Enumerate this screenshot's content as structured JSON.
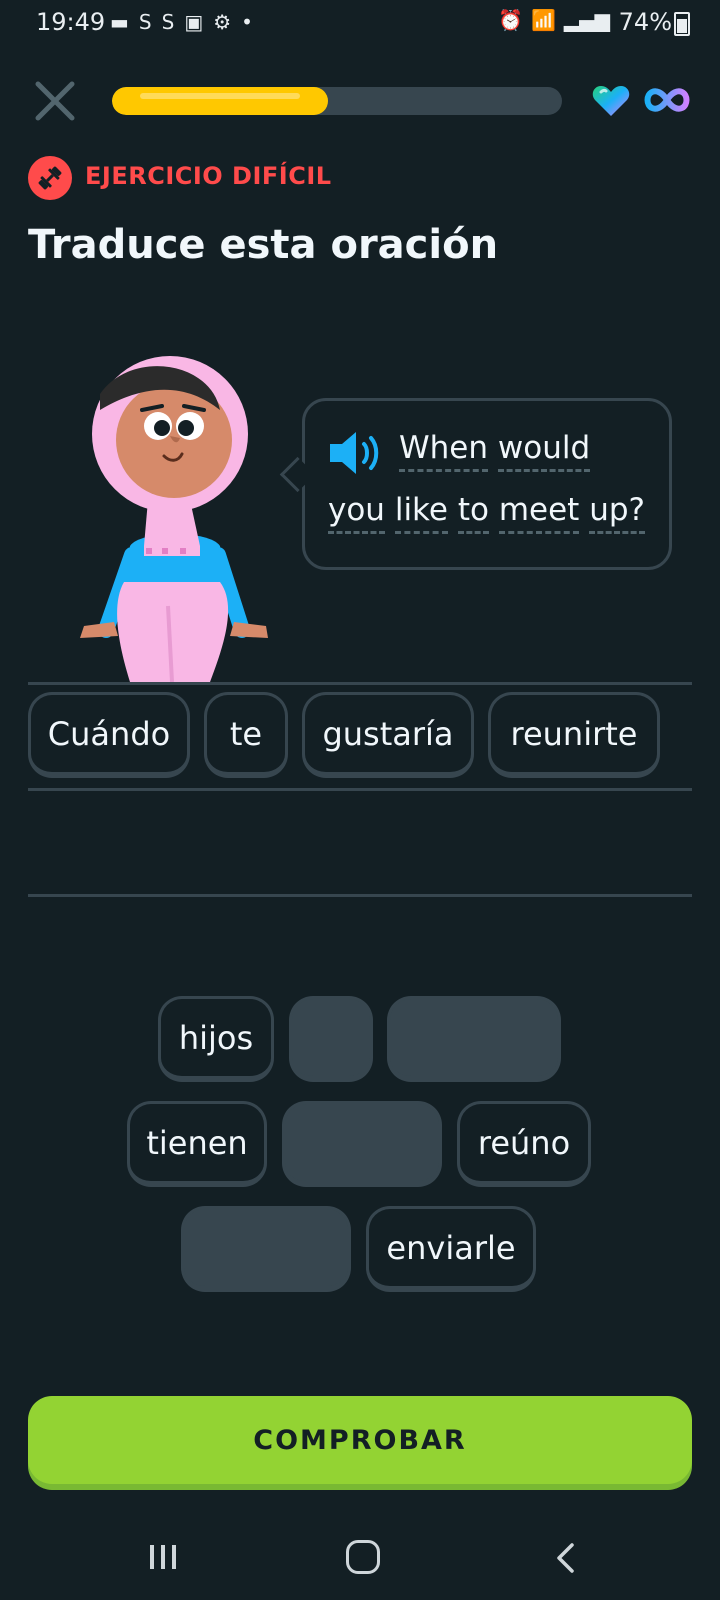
{
  "status_bar": {
    "time": "19:49",
    "battery": "74%"
  },
  "header": {
    "progress": 0.48,
    "close_icon": "close-icon",
    "hearts_icon": "heart-gem-icon",
    "infinity_icon": "infinity-icon"
  },
  "exercise": {
    "hard_label": "EJERCICIO DIFÍCIL",
    "title": "Traduce esta oración",
    "prompt_line1": "When would",
    "prompt_line2": "you like to meet up?",
    "prompt_words": [
      "When",
      "would",
      "you",
      "like",
      "to",
      "meet",
      "up?"
    ]
  },
  "answer_tiles": [
    "Cuándo",
    "te",
    "gustaría",
    "reunirte"
  ],
  "word_bank": {
    "row1": [
      "hijos",
      "",
      ""
    ],
    "row2": [
      "tienen",
      "",
      "reúno"
    ],
    "row3": [
      "",
      "enviarle"
    ]
  },
  "check_button": "COMPROBAR",
  "colors": {
    "background": "#131f24",
    "progress": "#ffc800",
    "hard": "#ff4b4b",
    "button": "#93d333",
    "speaker": "#1cb0f6"
  }
}
